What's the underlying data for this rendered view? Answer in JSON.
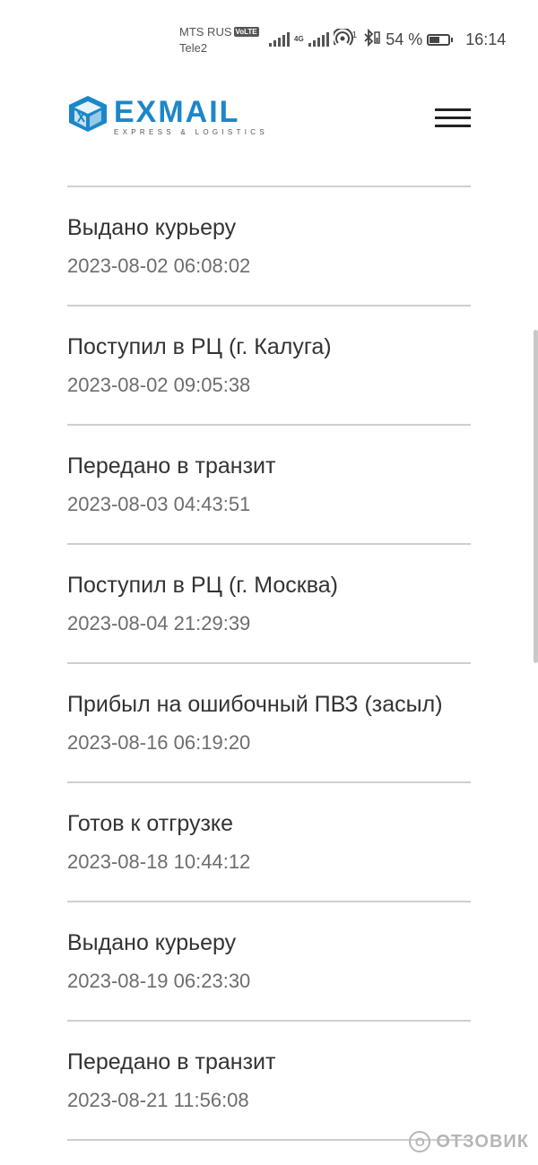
{
  "status_bar": {
    "carrier_1": "MTS RUS",
    "volte": "VoLTE",
    "carrier_2": "Tele2",
    "network": "4G",
    "hotspot_count": "1",
    "battery_percent": "54 %",
    "battery_level": 0.54,
    "time": "16:14"
  },
  "header": {
    "logo_word": "EXMAIL",
    "logo_tagline": "EXPRESS & LOGISTICS",
    "brand_color": "#1b87c9"
  },
  "tracking": {
    "events": [
      {
        "status": "Выдано курьеру",
        "datetime": "2023-08-02 06:08:02"
      },
      {
        "status": "Поступил в РЦ (г. Калуга)",
        "datetime": "2023-08-02 09:05:38"
      },
      {
        "status": "Передано в транзит",
        "datetime": "2023-08-03 04:43:51"
      },
      {
        "status": "Поступил в РЦ (г. Москва)",
        "datetime": "2023-08-04 21:29:39"
      },
      {
        "status": "Прибыл на ошибочный ПВЗ (засыл)",
        "datetime": "2023-08-16 06:19:20"
      },
      {
        "status": "Готов к отгрузке",
        "datetime": "2023-08-18 10:44:12"
      },
      {
        "status": "Выдано курьеру",
        "datetime": "2023-08-19 06:23:30"
      },
      {
        "status": "Передано в транзит",
        "datetime": "2023-08-21 11:56:08"
      }
    ]
  },
  "watermark": {
    "symbol": "О",
    "text": "ОТЗОВИК"
  }
}
